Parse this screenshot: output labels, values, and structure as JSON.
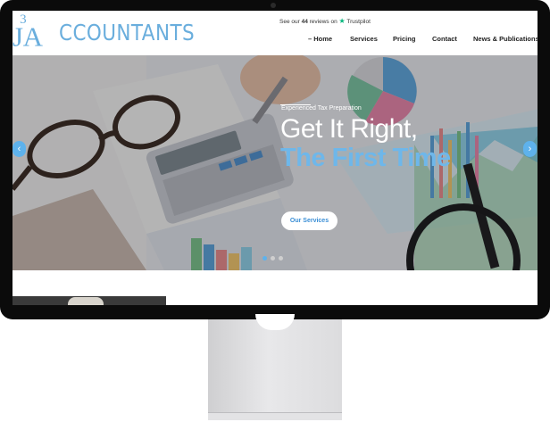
{
  "header": {
    "logo_mark": "J3A",
    "logo_text": "CCOUNTANTS",
    "trust": {
      "prefix": "See our",
      "count": "44",
      "suffix": "reviews on",
      "star_icon": "star-icon",
      "brand": "Trustpilot",
      "brand_color": "#00b67a"
    },
    "nav": [
      {
        "label": "– Home"
      },
      {
        "label": "Services"
      },
      {
        "label": "Pricing"
      },
      {
        "label": "Contact"
      },
      {
        "label": "News & Publications"
      }
    ]
  },
  "hero": {
    "eyebrow": "Experienced Tax Preparation",
    "headline_1": "Get It Right,",
    "headline_2": "The First Time",
    "cta_label": "Our Services",
    "prev_icon": "chevron-left-icon",
    "next_icon": "chevron-right-icon",
    "arrow_prev": "‹",
    "arrow_next": "›",
    "slides": 3,
    "active_slide": 1
  },
  "colors": {
    "brand": "#6aaedd",
    "accent_blue": "#3b8fd6",
    "headline_blue": "#6eb7ea"
  }
}
